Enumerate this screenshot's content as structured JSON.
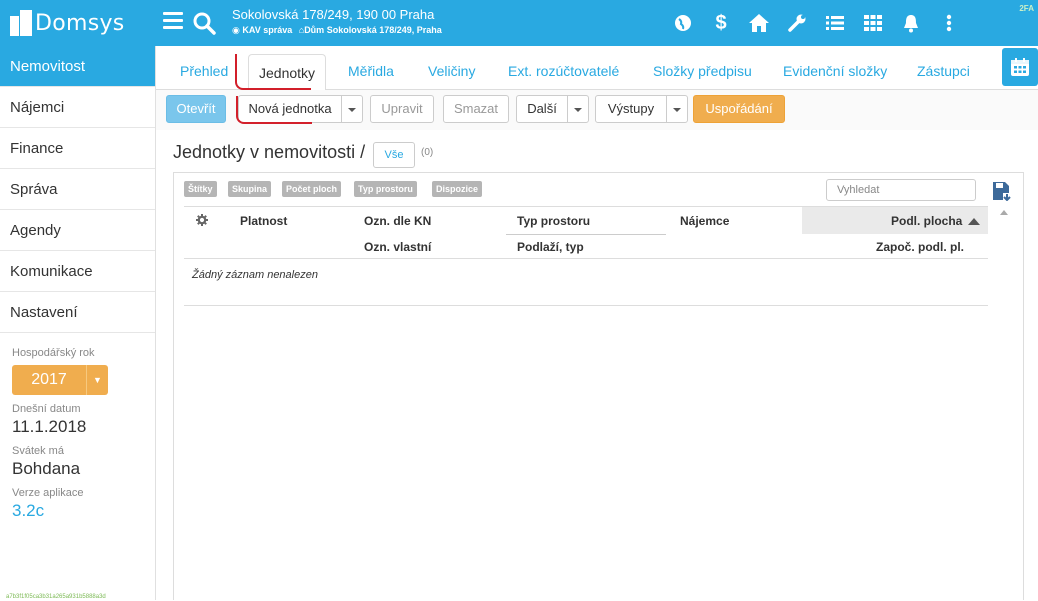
{
  "app": {
    "name": "Domsys",
    "tfa_badge": "2FA"
  },
  "header": {
    "address": "Sokolovská 178/249, 190 00 Praha",
    "sub_org": "KAV správa",
    "sub_house": "Dům Sokolovská 178/249, Praha"
  },
  "top_icons": [
    "globe-icon",
    "dollar-icon",
    "home-icon",
    "wrench-icon",
    "list-icon",
    "grid-icon",
    "bell-icon",
    "more-vertical-icon"
  ],
  "sidebar": {
    "items": [
      {
        "label": "Nemovitost",
        "active": true
      },
      {
        "label": "Nájemci"
      },
      {
        "label": "Finance"
      },
      {
        "label": "Správa"
      },
      {
        "label": "Agendy"
      },
      {
        "label": "Komunikace"
      },
      {
        "label": "Nastavení"
      }
    ],
    "fiscal_year_label": "Hospodářský rok",
    "fiscal_year_value": "2017",
    "today_label": "Dnešní datum",
    "today_value": "11.1.2018",
    "nameday_label": "Svátek má",
    "nameday_value": "Bohdana",
    "version_label": "Verze aplikace",
    "version_value": "3.2c",
    "build_hash": "a7b3f1f05ca3b31a265a931b5888a3d"
  },
  "tabs": [
    {
      "label": "Přehled"
    },
    {
      "label": "Jednotky",
      "active": true
    },
    {
      "label": "Měřidla"
    },
    {
      "label": "Veličiny"
    },
    {
      "label": "Ext. rozúčtovatelé"
    },
    {
      "label": "Složky předpisu"
    },
    {
      "label": "Evidenční složky"
    },
    {
      "label": "Zástupci"
    }
  ],
  "toolbar": {
    "open": "Otevřít",
    "new_unit": "Nová jednotka",
    "edit": "Upravit",
    "delete": "Smazat",
    "more": "Další",
    "outputs": "Výstupy",
    "arrange": "Uspořádání"
  },
  "content": {
    "title": "Jednotky v nemovitosti /",
    "all_button": "Vše",
    "count": "(0)",
    "filters": [
      "Štítky",
      "Skupina",
      "Počet ploch",
      "Typ prostoru",
      "Dispozice"
    ],
    "search_placeholder": "Vyhledat",
    "columns": {
      "validity": "Platnost",
      "kn_label": "Ozn. dle KN",
      "own_label": "Ozn. vlastní",
      "space_type": "Typ prostoru",
      "floor_type": "Podlaží, typ",
      "tenant": "Nájemce",
      "floor_area": "Podl. plocha",
      "counted_area": "Započ. podl. pl."
    },
    "empty_text": "Žádný záznam nenalezen"
  }
}
